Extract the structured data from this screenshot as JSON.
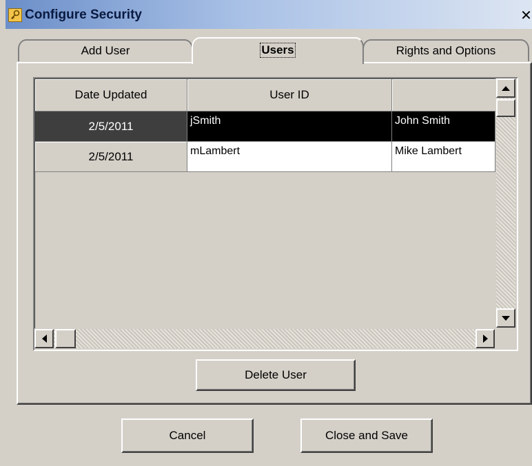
{
  "window": {
    "title": "Configure Security",
    "close_label": "✕"
  },
  "tabs": [
    {
      "label": "Add User"
    },
    {
      "label": "Users"
    },
    {
      "label": "Rights and Options"
    }
  ],
  "grid": {
    "columns": [
      "Date Updated",
      "User ID",
      ""
    ],
    "rows": [
      {
        "date_updated": "2/5/2011",
        "user_id": "jSmith",
        "name": "John Smith",
        "selected": true
      },
      {
        "date_updated": "2/5/2011",
        "user_id": "mLambert",
        "name": "Mike Lambert",
        "selected": false
      }
    ]
  },
  "buttons": {
    "delete_user": "Delete User",
    "cancel": "Cancel",
    "close_and_save": "Close and Save"
  },
  "colors": {
    "selected_row": "#000000",
    "selected_header_cell": "#3e3e3e",
    "face": "#d4d0c8"
  }
}
